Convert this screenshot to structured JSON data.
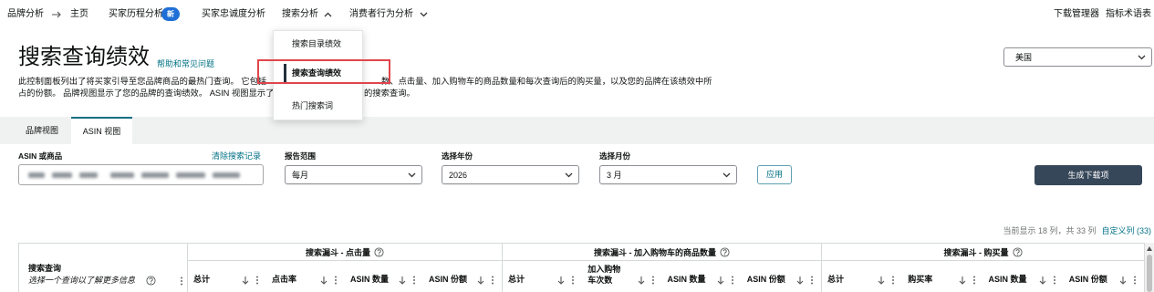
{
  "nav": {
    "root": "品牌分析",
    "home": "主页",
    "journey": "买家历程分析",
    "journey_badge": "新",
    "loyalty": "买家忠诚度分析",
    "search": "搜索分析",
    "consumer": "消费者行为分析",
    "download_manager": "下载管理器",
    "glossary": "指标术语表"
  },
  "icons": {
    "breadcrumb_separator": "arrow-right-icon",
    "search_menu_toggle": "chevron-up-icon",
    "consumer_menu_toggle": "chevron-down-icon",
    "select_toggle": "chevron-down-icon",
    "help": "help-circle-icon",
    "sort": "sort-down-icon",
    "column_menu": "vertical-dots-icon",
    "scroll_up": "scroll-up-arrow-icon"
  },
  "search_menu": {
    "items": [
      {
        "label": "搜索目录绩效",
        "selected": false
      },
      {
        "label": "搜索查询绩效",
        "selected": true
      },
      {
        "label": "热门搜索词",
        "selected": false
      }
    ]
  },
  "page": {
    "title": "搜索查询绩效",
    "help_link": "帮助和常见问题",
    "description": {
      "line1_a": "此控制面板列出了将买家引导至您品牌商品的最热门查询。 它包括",
      "line1_b": "数、点击量、加入购物车的商品数量和每次查询后的购买量，以及您的品牌在该绩效中所",
      "line2_a": "占的份额。 品牌视图显示了您的品牌的查询绩效。 ASIN 视图显示了",
      "line2_b": "的搜索查询。"
    }
  },
  "marketplace": {
    "selected": "美国"
  },
  "tabs": [
    {
      "label": "品牌视图",
      "active": false
    },
    {
      "label": "ASIN 视图",
      "active": true
    }
  ],
  "filters": {
    "asin_label": "ASIN 或商品",
    "clear_history": "清除搜索记录",
    "range_label": "报告范围",
    "range_value": "每月",
    "year_label": "选择年份",
    "year_value": "2026",
    "month_label": "选择月份",
    "month_value": "3 月",
    "apply": "应用",
    "generate_download": "生成下载项"
  },
  "columns_info": {
    "status": "当前显示 18 列，共 33 列",
    "customize": "自定义列 (33)"
  },
  "table": {
    "query_header": "搜索查询",
    "query_hint": "选择一个查询以了解更多信息",
    "groups": [
      {
        "label": "搜索漏斗 - 点击量",
        "columns": [
          "总计",
          "点击率",
          "ASIN 数量",
          "ASIN 份额"
        ]
      },
      {
        "label": "搜索漏斗 - 加入购物车的商品数量",
        "columns": [
          "总计",
          "加入购物车次数",
          "ASIN 数量",
          "ASIN 份额"
        ]
      },
      {
        "label": "搜索漏斗 - 购买量",
        "columns": [
          "总计",
          "购买率",
          "ASIN 数量",
          "ASIN 份额"
        ]
      }
    ]
  },
  "colors": {
    "link": "#007185",
    "badge": "#1f6fd6",
    "highlight_box": "#e0464b",
    "primary_button": "#37475a",
    "tab_bar": "#f0f2f2",
    "active_tab_border": "#0f6f80"
  }
}
